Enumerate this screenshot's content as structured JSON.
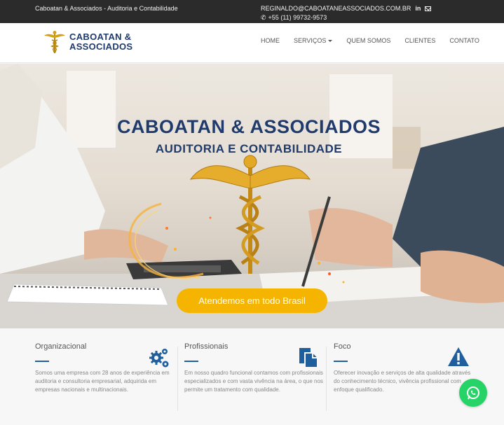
{
  "topbar": {
    "tagline": "Caboatan & Associados - Auditoria e Contabilidade",
    "email": "REGINALDO@CABOATANEASSOCIADOS.COM.BR",
    "linkedin": "in",
    "phone": "+55 (11) 99732-9573"
  },
  "brand": {
    "line1": "CABOATAN &",
    "line2": "ASSOCIADOS",
    "logo_icon": "caduceus-icon"
  },
  "nav": {
    "home": "HOME",
    "services": "SERVIÇOS",
    "about": "QUEM SOMOS",
    "clients": "CLIENTES",
    "contact": "CONTATO"
  },
  "hero": {
    "title": "CABOATAN & ASSOCIADOS",
    "subtitle": "AUDITORIA E CONTABILIDADE",
    "cta": "Atendemos em todo Brasil"
  },
  "features": [
    {
      "title": "Organizacional",
      "text": "Somos uma empresa com 28 anos de experiência em auditoria e consultoria empresarial, adquirida em empresas nacionais e multinacionais.",
      "icon": "gears-icon"
    },
    {
      "title": "Profissionais",
      "text": "Em nosso quadro funcional contamos com profissionais especializados e com vasta vivência na área, o que nos permite um tratamento com qualidade.",
      "icon": "documents-icon"
    },
    {
      "title": "Foco",
      "text": "Oferecer inovação e serviços de alta qualidade através do conhecimento técnico, vivência profissional com enfoque qualificado.",
      "icon": "warning-icon"
    }
  ],
  "colors": {
    "topbar": "#2b2b2b",
    "brand_blue": "#1f3a6b",
    "accent_gold": "#f4b400",
    "icon_blue": "#1f5f9e",
    "whatsapp": "#25d366"
  }
}
